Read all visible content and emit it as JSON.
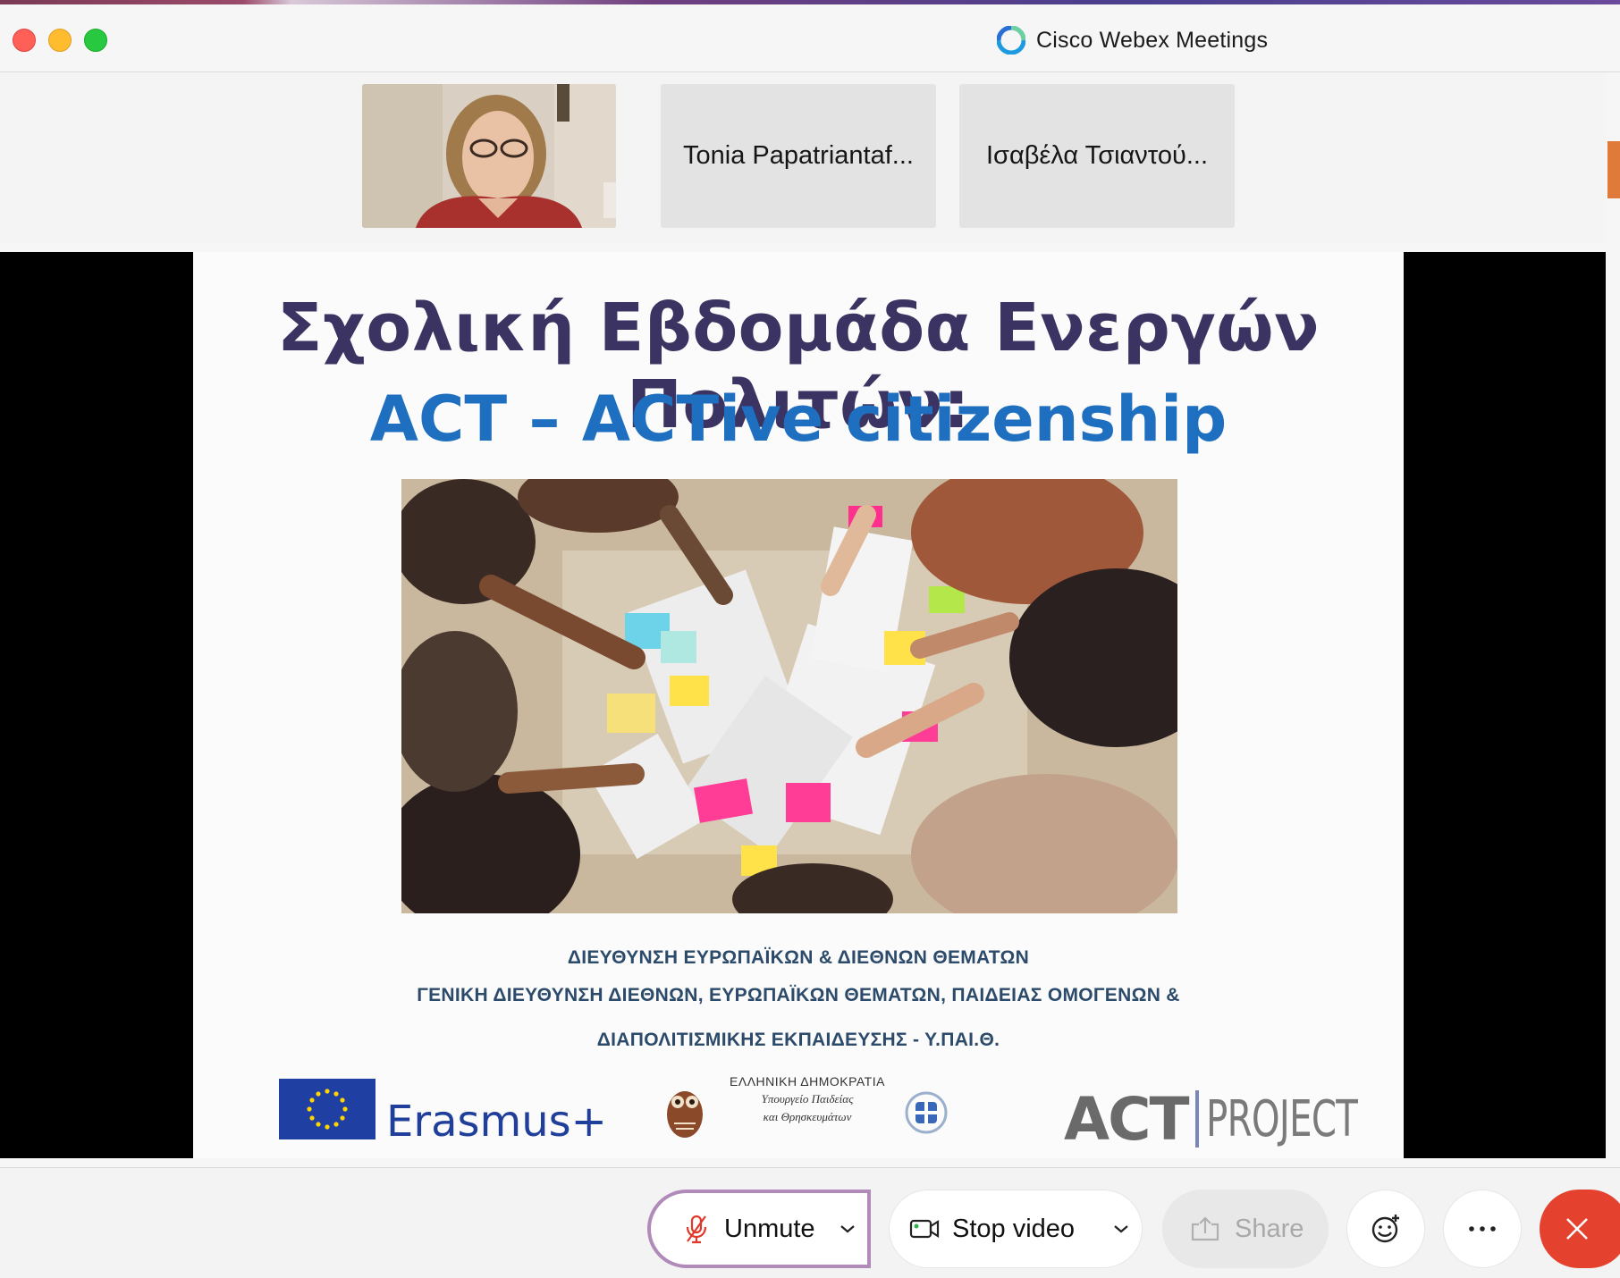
{
  "window": {
    "title": "Cisco Webex Meetings"
  },
  "participants": [
    {
      "name": "",
      "has_video": true
    },
    {
      "name": "Tonia Papatriantaf...",
      "has_video": false
    },
    {
      "name": "Ισαβέλα Τσιαντού...",
      "has_video": false
    }
  ],
  "slide": {
    "title": "Σχολική Εβδομάδα Ενεργών Πολιτών:",
    "subtitle": "ACT – ACTive citizenship",
    "org_line1": "ΔΙΕΥΘΥΝΣΗ ΕΥΡΩΠΑΪΚΩΝ & ΔΙΕΘΝΩΝ ΘΕΜΑΤΩΝ",
    "org_line2": "ΓΕΝΙΚΗ ΔΙΕΥΘΥΝΣΗ ΔΙΕΘΝΩΝ, ΕΥΡΩΠΑΪΚΩΝ ΘΕΜΑΤΩΝ, ΠΑΙΔΕΙΑΣ ΟΜΟΓΕΝΩΝ &",
    "org_line3": "ΔΙΑΠΟΛΙΤΙΣΜΙΚΗΣ ΕΚΠΑΙΔΕΥΣΗΣ - Υ.ΠΑΙ.Θ.",
    "erasmus_label": "Erasmus+",
    "gov_line1": "ΕΛΛΗΝΙΚΗ ΔΗΜΟΚΡΑΤΙΑ",
    "gov_line2": "Υπουργείο Παιδείας",
    "gov_line3": "και Θρησκευμάτων",
    "act_bold": "ACT",
    "act_light": "PROJECT"
  },
  "controls": {
    "unmute_label": "Unmute",
    "video_label": "Stop video",
    "share_label": "Share"
  },
  "colors": {
    "end_call": "#e5412f",
    "unmute_outline": "#b08ab8",
    "slide_title": "#3b3361",
    "slide_subtitle": "#1f6fc1"
  },
  "icons": [
    "mic-muted-icon",
    "chevron-down-icon",
    "camera-icon",
    "share-screen-icon",
    "emoji-icon",
    "more-icon",
    "close-icon",
    "webex-logo-icon"
  ]
}
